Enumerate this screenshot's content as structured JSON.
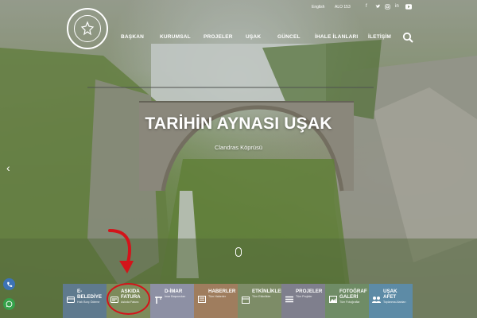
{
  "topbar": {
    "links": [
      "English",
      "ALO 153"
    ],
    "social_icons": [
      "facebook-icon",
      "twitter-icon",
      "instagram-icon",
      "linkedin-icon",
      "youtube-icon"
    ]
  },
  "nav": {
    "items": [
      "BAŞKAN",
      "KURUMSAL",
      "PROJELER",
      "UŞAK",
      "GÜNCEL",
      "İHALE İLANLARI",
      "İLETİŞİM"
    ],
    "search_icon": "search-icon"
  },
  "hero": {
    "title": "TARİHİN AYNASI UŞAK",
    "subtitle": "Clandras Köprüsü"
  },
  "tiles": [
    {
      "title": "E-BELEDİYE",
      "sub": "Hızlı Borç Ödeme",
      "color": "#5f7a8e",
      "icon": "card-icon"
    },
    {
      "title": "ASKIDA FATURA",
      "sub": "Askıda Fatura",
      "color": "#7d8b5b",
      "icon": "invoice-icon"
    },
    {
      "title": "D-İMAR",
      "sub": "İmar Başvuruları",
      "color": "#8d90a4",
      "icon": "crane-icon"
    },
    {
      "title": "HABERLER",
      "sub": "Tüm Haberler",
      "color": "#9f7d5e",
      "icon": "news-icon"
    },
    {
      "title": "ETKİNLİKLER",
      "sub": "Tüm Etkinlikler",
      "color": "#7d8c67",
      "icon": "calendar-icon"
    },
    {
      "title": "PROJELER",
      "sub": "Tüm Projeler",
      "color": "#7f7f8d",
      "icon": "list-icon"
    },
    {
      "title": "FOTOĞRAF GALERİ",
      "sub": "Tüm Fotoğraflar",
      "color": "#6f8c66",
      "icon": "gallery-icon"
    },
    {
      "title": "UŞAK AFET",
      "sub": "Toplanma Alanları",
      "color": "#5d8ba6",
      "icon": "people-icon"
    }
  ],
  "side_buttons": [
    "phone-icon",
    "whatsapp-icon"
  ],
  "annotation": {
    "color": "#d3141a"
  }
}
